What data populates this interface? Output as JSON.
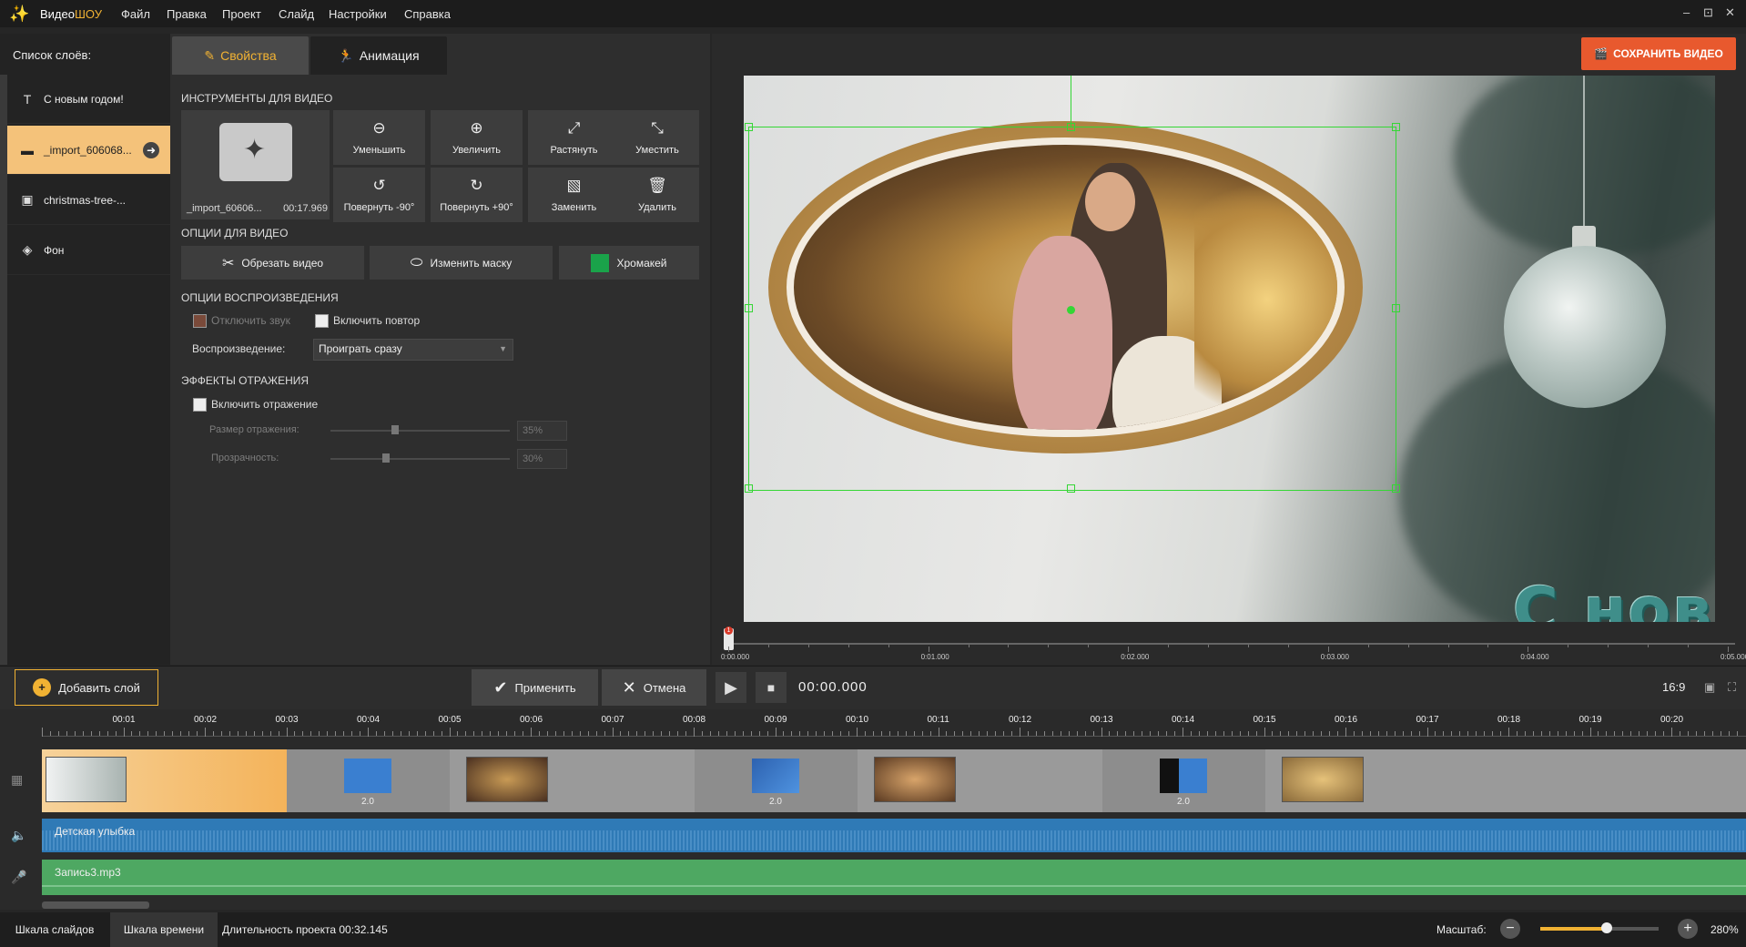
{
  "app": {
    "name_part1": "Видео",
    "name_part2": "ШОУ"
  },
  "menu": [
    "Файл",
    "Правка",
    "Проект",
    "Слайд",
    "Настройки",
    "Справка"
  ],
  "window_controls": [
    "–",
    "⊡",
    "✕"
  ],
  "layers": {
    "title": "Список слоёв:",
    "items": [
      {
        "label": "С новым годом!",
        "icon": "text-icon"
      },
      {
        "label": "_import_606068...",
        "icon": "video-icon",
        "selected": true
      },
      {
        "label": "christmas-tree-...",
        "icon": "image-icon"
      },
      {
        "label": "Фон",
        "icon": "fill-icon"
      }
    ]
  },
  "tabs": {
    "properties": "Свойства",
    "animation": "Анимация"
  },
  "video_tools": {
    "title": "ИНСТРУМЕНТЫ ДЛЯ ВИДЕО",
    "thumb_name": "_import_60606...",
    "thumb_duration": "00:17.969",
    "buttons": [
      "Уменьшить",
      "Увеличить",
      "Растянуть",
      "Уместить",
      "Повернуть -90°",
      "Повернуть +90°",
      "Заменить",
      "Удалить"
    ]
  },
  "video_options": {
    "title": "ОПЦИИ ДЛЯ ВИДЕО",
    "trim": "Обрезать видео",
    "mask": "Изменить маску",
    "chroma": "Хромакей"
  },
  "playback": {
    "title": "ОПЦИИ ВОСПРОИЗВЕДЕНИЯ",
    "mute": "Отключить звук",
    "loop": "Включить повтор",
    "play_label": "Воспроизведение:",
    "play_value": "Проиграть сразу"
  },
  "reflection": {
    "title": "ЭФФЕКТЫ ОТРАЖЕНИЯ",
    "enable": "Включить отражение",
    "size_label": "Размер отражения:",
    "size_value": "35%",
    "size_fraction": 0.35,
    "opacity_label": "Прозрачность:",
    "opacity_value": "30%",
    "opacity_fraction": 0.3
  },
  "save_button": "СОХРАНИТЬ ВИДЕО",
  "preview": {
    "greeting": "С новым годом!"
  },
  "preview_ruler": [
    "0:00.000",
    "0:01.000",
    "0:02.000",
    "0:03.000",
    "0:04.000",
    "0:05.000"
  ],
  "toolbar": {
    "add_layer": "Добавить слой",
    "apply": "Применить",
    "cancel": "Отмена",
    "timecode": "00:00.000",
    "ratio": "16:9"
  },
  "timeline": {
    "labels": [
      "00:01",
      "00:02",
      "00:03",
      "00:04",
      "00:05",
      "00:06",
      "00:07",
      "00:08",
      "00:09",
      "00:10",
      "00:11",
      "00:12",
      "00:13",
      "00:14",
      "00:15",
      "00:16",
      "00:17",
      "00:18",
      "00:19",
      "00:20"
    ],
    "transition_values": [
      "2.0",
      "2.0",
      "2.0"
    ],
    "audio1": "Детская улыбка",
    "audio2": "Запись3.mp3"
  },
  "status": {
    "slides_tab": "Шкала слайдов",
    "timeline_tab": "Шкала времени",
    "duration": "Длительность проекта 00:32.145",
    "zoom_label": "Масштаб:",
    "zoom_value": "280%"
  },
  "colors": {
    "accent": "#f1b233",
    "save": "#e8592e",
    "selection": "#35d635",
    "audio1": "#2f7ab6",
    "audio2": "#4ea862"
  }
}
